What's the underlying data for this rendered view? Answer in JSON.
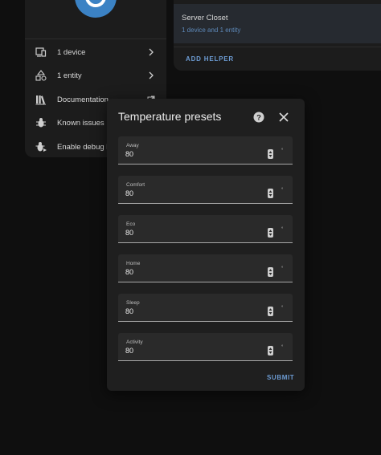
{
  "left_card": {
    "items": [
      {
        "label": "1 device",
        "icon": "devices-icon"
      },
      {
        "label": "1 entity",
        "icon": "entity-shapes-icon"
      },
      {
        "label": "Documentation",
        "icon": "book-icon"
      },
      {
        "label": "Known issues",
        "icon": "bug-icon"
      },
      {
        "label": "Enable debug lo",
        "icon": "bug-play-icon"
      }
    ]
  },
  "right_card": {
    "area_title": "Server Closet",
    "area_sub": "1 device and 1 entity",
    "add_helper": "ADD HELPER"
  },
  "dialog": {
    "title": "Temperature presets",
    "fields": [
      {
        "label": "Away",
        "value": "80",
        "unit": "°"
      },
      {
        "label": "Comfort",
        "value": "80",
        "unit": "°"
      },
      {
        "label": "Eco",
        "value": "80",
        "unit": "°"
      },
      {
        "label": "Home",
        "value": "80",
        "unit": "°"
      },
      {
        "label": "Sleep",
        "value": "80",
        "unit": "°"
      },
      {
        "label": "Activity",
        "value": "80",
        "unit": "°"
      }
    ],
    "submit": "SUBMIT"
  },
  "colors": {
    "accent": "#6c9bd2",
    "avatar": "#3b82c4",
    "dialog_bg": "#1f1f1f",
    "field_bg": "#2a2a2a"
  }
}
